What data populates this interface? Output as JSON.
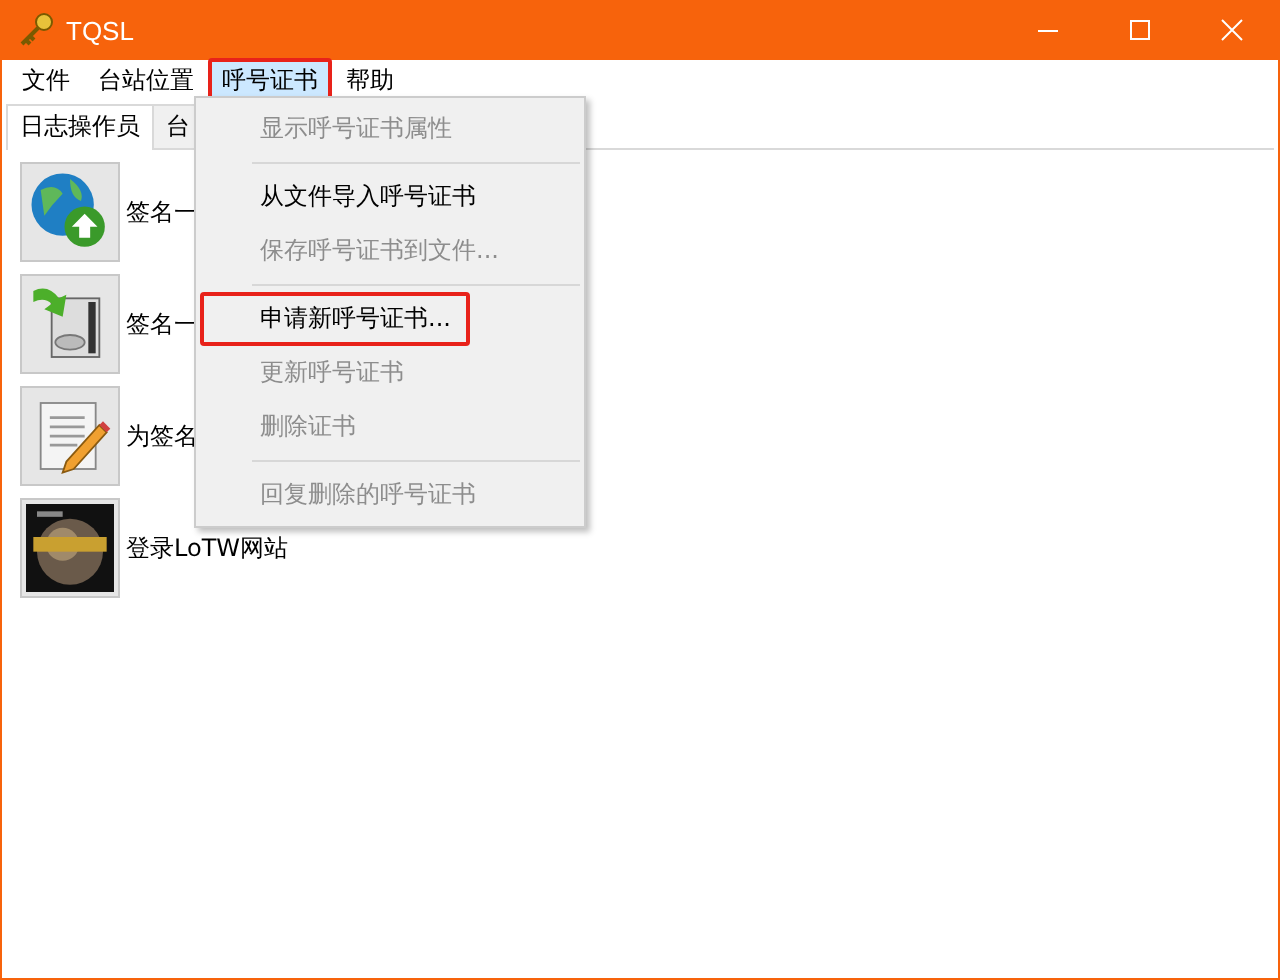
{
  "window": {
    "title": "TQSL"
  },
  "menu_bar": [
    {
      "label": "文件",
      "open": false,
      "highlighted": false
    },
    {
      "label": "台站位置",
      "open": false,
      "highlighted": false
    },
    {
      "label": "呼号证书",
      "open": true,
      "highlighted": true
    },
    {
      "label": "帮助",
      "open": false,
      "highlighted": false
    }
  ],
  "tabs": [
    {
      "label": "日志操作员",
      "selected": true
    },
    {
      "label": "台",
      "selected": false
    }
  ],
  "actions": [
    {
      "kind": "globe",
      "label": "签名一"
    },
    {
      "kind": "disk",
      "label": "签名一"
    },
    {
      "kind": "notepad",
      "label": "为签名"
    },
    {
      "kind": "logbook",
      "label": "登录LoTW网站"
    }
  ],
  "dropdown": [
    {
      "kind": "item",
      "label": "显示呼号证书属性",
      "disabled": true,
      "highlighted": false
    },
    {
      "kind": "separator"
    },
    {
      "kind": "item",
      "label": "从文件导入呼号证书",
      "disabled": false,
      "highlighted": false
    },
    {
      "kind": "item",
      "label": "保存呼号证书到文件...",
      "disabled": true,
      "highlighted": false
    },
    {
      "kind": "separator"
    },
    {
      "kind": "item",
      "label": "申请新呼号证书...",
      "disabled": false,
      "highlighted": true
    },
    {
      "kind": "item",
      "label": "更新呼号证书",
      "disabled": true,
      "highlighted": false
    },
    {
      "kind": "item",
      "label": "删除证书",
      "disabled": true,
      "highlighted": false
    },
    {
      "kind": "separator"
    },
    {
      "kind": "item",
      "label": "回复删除的呼号证书",
      "disabled": true,
      "highlighted": false
    }
  ]
}
